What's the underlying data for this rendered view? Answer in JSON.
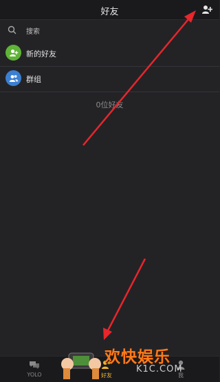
{
  "header": {
    "title": "好友",
    "add_icon": "add-friend-icon"
  },
  "search": {
    "placeholder": "搜索"
  },
  "items": [
    {
      "label": "新的好友",
      "icon": "new-friend-icon",
      "color": "#5fb336"
    },
    {
      "label": "群组",
      "icon": "group-icon",
      "color": "#3b7fd1"
    }
  ],
  "count_text": "0位好友",
  "nav": [
    {
      "label": "YOLO",
      "icon": "chat-icon",
      "active": false
    },
    {
      "label": "好友",
      "icon": "friends-icon",
      "active": true
    },
    {
      "label": "我",
      "icon": "profile-icon",
      "active": false
    }
  ],
  "colors": {
    "background": "#232326",
    "bar": "#1a1a1d",
    "active": "#f0b52a",
    "arrow": "#e8262b"
  },
  "watermark": {
    "main": "欢快娱乐",
    "sub": "K1C.COM"
  }
}
